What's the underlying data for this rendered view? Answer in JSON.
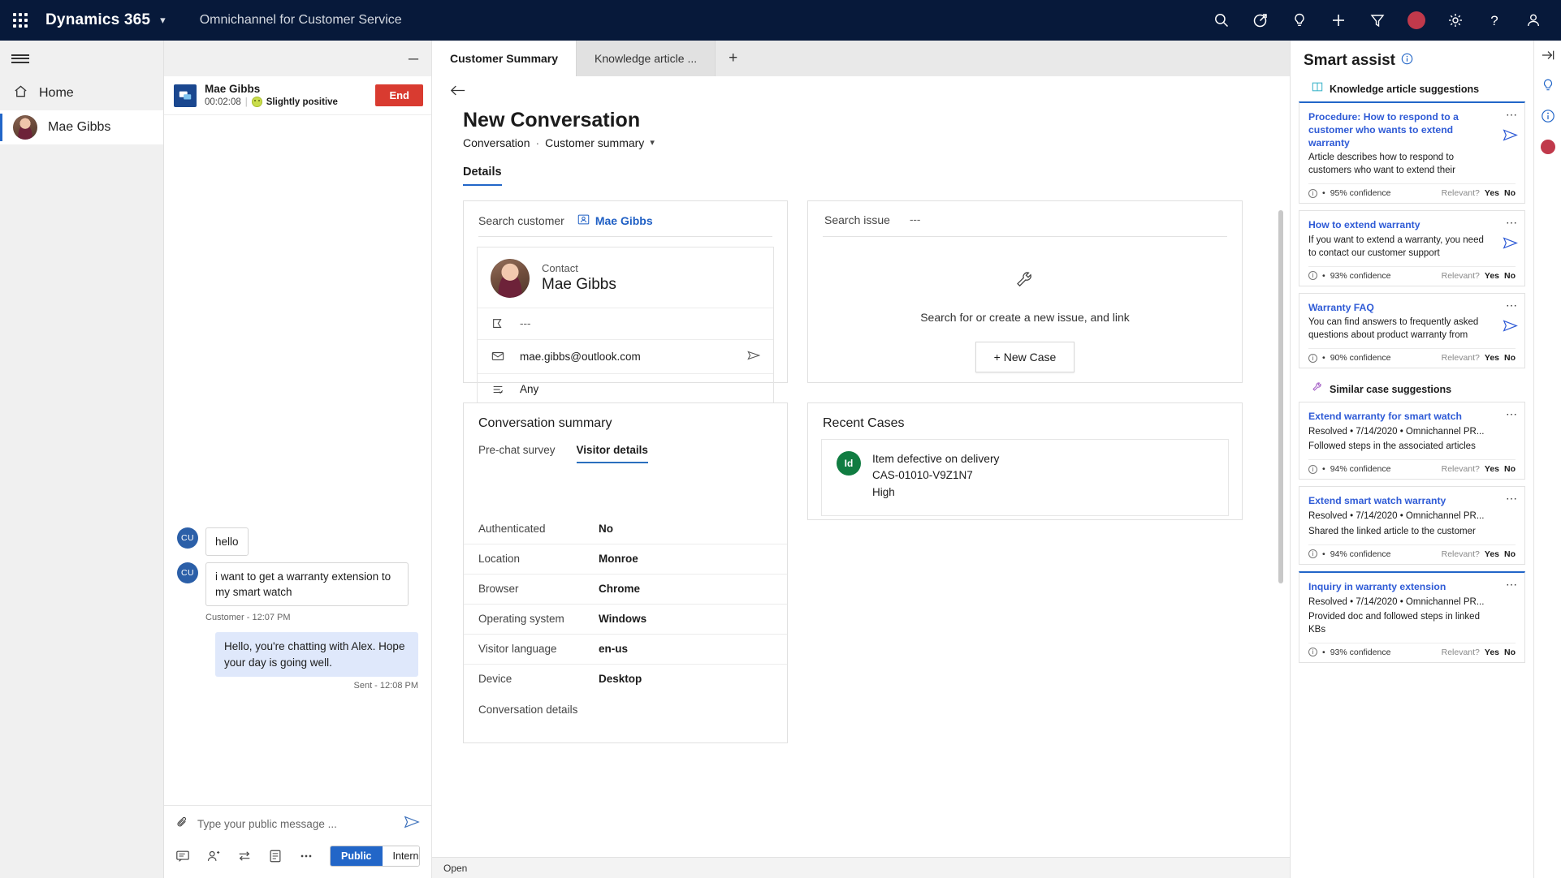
{
  "topbar": {
    "brand": "Dynamics 365",
    "app_name": "Omnichannel for Customer Service",
    "icons": [
      "search-icon",
      "assistant-icon",
      "lightbulb-icon",
      "plus-icon",
      "filter-icon",
      "presence-dot",
      "gear-icon",
      "help-icon",
      "account-icon"
    ]
  },
  "sidebar": {
    "items": [
      {
        "label": "Home",
        "icon": "home-icon"
      },
      {
        "label": "Mae Gibbs",
        "icon": "avatar"
      }
    ]
  },
  "conversation": {
    "customer": "Mae Gibbs",
    "duration": "00:02:08",
    "sentiment": "Slightly positive",
    "end_label": "End",
    "messages": [
      {
        "author": "CU",
        "text": "hello",
        "side": "in"
      },
      {
        "author": "CU",
        "text": "i want to get a warranty extension to my smart watch",
        "side": "in"
      }
    ],
    "inbound_time": "Customer - 12:07 PM",
    "agent_message": "Hello, you're chatting with Alex. Hope your day is going well.",
    "agent_time": "Sent - 12:08 PM",
    "composer_placeholder": "Type your public message ...",
    "composer_value": "",
    "mode_public": "Public",
    "mode_internal": "Internal"
  },
  "tabs": [
    {
      "label": "Customer Summary",
      "active": true
    },
    {
      "label": "Knowledge article ...",
      "active": false
    }
  ],
  "page": {
    "title": "New Conversation",
    "breadcrumb_entity": "Conversation",
    "breadcrumb_form": "Customer summary",
    "details_tab": "Details"
  },
  "customer_card": {
    "search_label": "Search customer",
    "chip_name": "Mae Gibbs",
    "contact_label": "Contact",
    "contact_name": "Mae Gibbs",
    "rows": [
      {
        "icon": "pennant-icon",
        "value": "---"
      },
      {
        "icon": "mail-icon",
        "value": "mae.gibbs@outlook.com",
        "end_icon": "send-mail-icon"
      },
      {
        "icon": "list-icon",
        "value": "Any"
      }
    ]
  },
  "issue_card": {
    "search_label": "Search issue",
    "search_value": "---",
    "empty_icon": "wrench-icon",
    "empty_text": "Search for or create a new issue, and link",
    "new_case_label": "+ New Case"
  },
  "conversation_summary": {
    "title": "Conversation summary",
    "tabs": [
      {
        "label": "Pre-chat survey",
        "active": false
      },
      {
        "label": "Visitor details",
        "active": true
      }
    ],
    "details": [
      {
        "key": "Authenticated",
        "value": "No"
      },
      {
        "key": "Location",
        "value": "Monroe"
      },
      {
        "key": "Browser",
        "value": "Chrome"
      },
      {
        "key": "Operating system",
        "value": "Windows"
      },
      {
        "key": "Visitor language",
        "value": "en-us"
      },
      {
        "key": "Device",
        "value": "Desktop"
      }
    ],
    "footer": "Conversation details"
  },
  "recent_cases": {
    "title": "Recent Cases",
    "items": [
      {
        "badge": "Id",
        "title": "Item defective on delivery",
        "number": "CAS-01010-V9Z1N7",
        "priority": "High"
      }
    ]
  },
  "smart_assist": {
    "title": "Smart assist",
    "sections": [
      {
        "label": "Knowledge article suggestions",
        "icon": "book-icon",
        "cards": [
          {
            "title": "Procedure: How to respond to a customer who wants to extend warranty",
            "desc": "Article describes how to respond to customers who want to extend their",
            "confidence": "95% confidence",
            "relevant_label": "Relevant?",
            "yes": "Yes",
            "no": "No",
            "highlight": true
          },
          {
            "title": "How to extend warranty",
            "desc": "If you want to extend a warranty, you need to contact our customer support",
            "confidence": "93% confidence",
            "relevant_label": "Relevant?",
            "yes": "Yes",
            "no": "No",
            "highlight": false
          },
          {
            "title": "Warranty FAQ",
            "desc": "You can find answers to frequently asked questions about product warranty from",
            "confidence": "90% confidence",
            "relevant_label": "Relevant?",
            "yes": "Yes",
            "no": "No",
            "highlight": false
          }
        ]
      },
      {
        "label": "Similar case suggestions",
        "icon": "wrench-icon",
        "cards": [
          {
            "title": "Extend warranty for smart watch",
            "meta": "Resolved • 7/14/2020 • Omnichannel PR...",
            "desc": "Followed steps in the associated articles",
            "confidence": "94% confidence",
            "relevant_label": "Relevant?",
            "yes": "Yes",
            "no": "No",
            "highlight": false
          },
          {
            "title": "Extend smart watch warranty",
            "meta": "Resolved • 7/14/2020 • Omnichannel PR...",
            "desc": "Shared the linked article to the customer",
            "confidence": "94% confidence",
            "relevant_label": "Relevant?",
            "yes": "Yes",
            "no": "No",
            "highlight": false
          },
          {
            "title": "Inquiry in warranty extension",
            "meta": "Resolved • 7/14/2020 • Omnichannel PR...",
            "desc": "Provided doc and followed steps in linked KBs",
            "confidence": "93% confidence",
            "relevant_label": "Relevant?",
            "yes": "Yes",
            "no": "No",
            "highlight": true
          }
        ]
      }
    ]
  },
  "status_bar": {
    "label": "Open"
  },
  "colors": {
    "topbar": "#07193a",
    "accent_blue": "#2266c8",
    "link_blue": "#2f5bd6",
    "end_red": "#d93b30",
    "presence_red": "#c0394b",
    "case_green": "#107c41"
  }
}
